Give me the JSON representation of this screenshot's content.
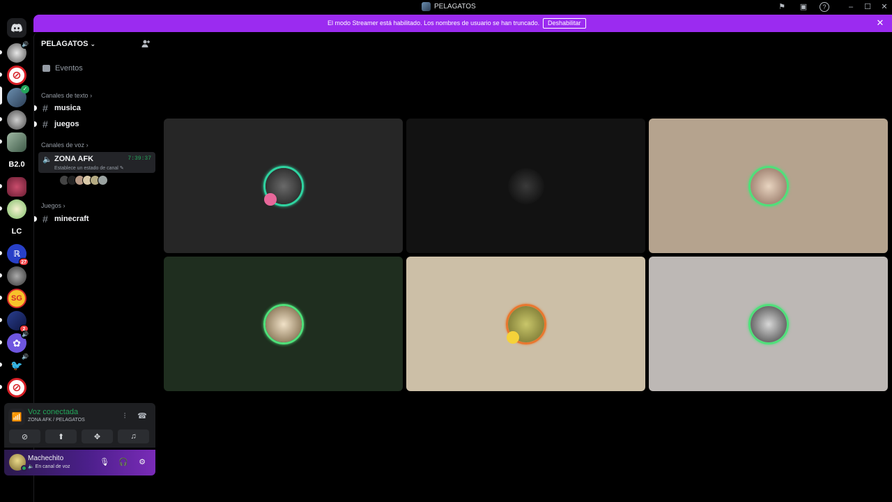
{
  "window": {
    "title": "PELAGATOS"
  },
  "banner": {
    "text": "El modo Streamer está habilitado. Los nombres de usuario se han truncado.",
    "button": "Deshabilitar"
  },
  "rail": {
    "text_servers": [
      "B2.0",
      "LC"
    ],
    "badges": [
      "27",
      "2"
    ]
  },
  "sidebar": {
    "server_name": "PELAGATOS",
    "events_label": "Eventos",
    "categories": {
      "text": "Canales de texto",
      "voice": "Canales de voz",
      "games": "Juegos"
    },
    "channels": {
      "musica": "musica",
      "juegos": "juegos",
      "minecraft": "minecraft"
    },
    "voice_channel": {
      "name": "ZONA AFK",
      "timer": "7:39:37",
      "status_hint": "Establece un estado de canal"
    }
  },
  "voice_panel": {
    "title": "Voz conectada",
    "location": "ZONA AFK / PELAGATOS"
  },
  "user_panel": {
    "username": "Machechito",
    "status": "En canal de voz"
  },
  "colors": {
    "banner": "#9b2bf0",
    "connected": "#23a55a",
    "tile_backgrounds": [
      "#262626",
      "#121212",
      "#b5a38e",
      "#1f2e1f",
      "#ccbfa7",
      "#bdb8b5"
    ]
  }
}
